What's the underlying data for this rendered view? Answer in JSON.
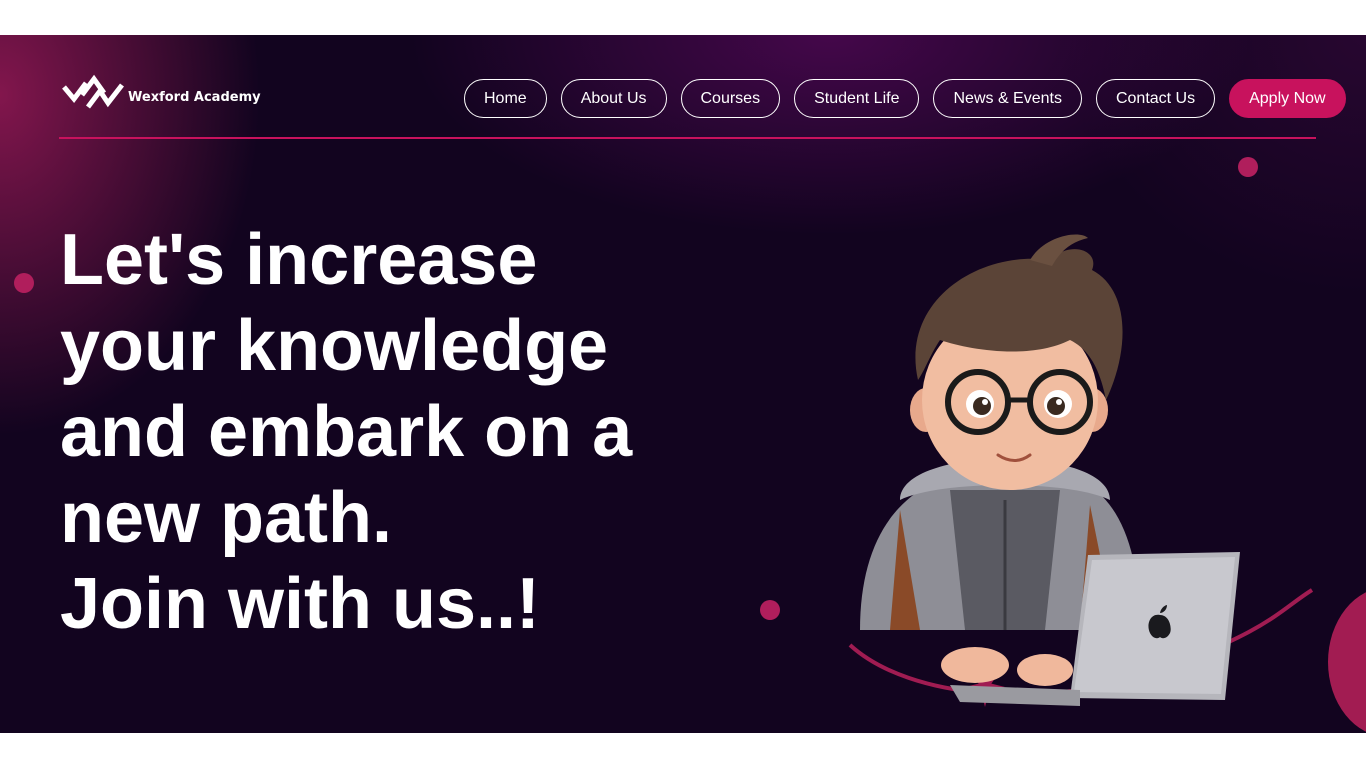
{
  "brand": {
    "name": "Wexford Academy",
    "accent": "#c8125d",
    "background": "#12041f"
  },
  "nav": {
    "items": [
      {
        "label": "Home"
      },
      {
        "label": "About Us"
      },
      {
        "label": "Courses"
      },
      {
        "label": "Student Life"
      },
      {
        "label": "News & Events"
      },
      {
        "label": "Contact Us"
      }
    ],
    "cta_label": "Apply Now"
  },
  "hero": {
    "headline_lines": [
      "Let's increase",
      "your knowledge",
      "and embark on a",
      "new path.",
      "Join with us..!"
    ],
    "illustration_icon": "student-with-laptop-illustration"
  }
}
